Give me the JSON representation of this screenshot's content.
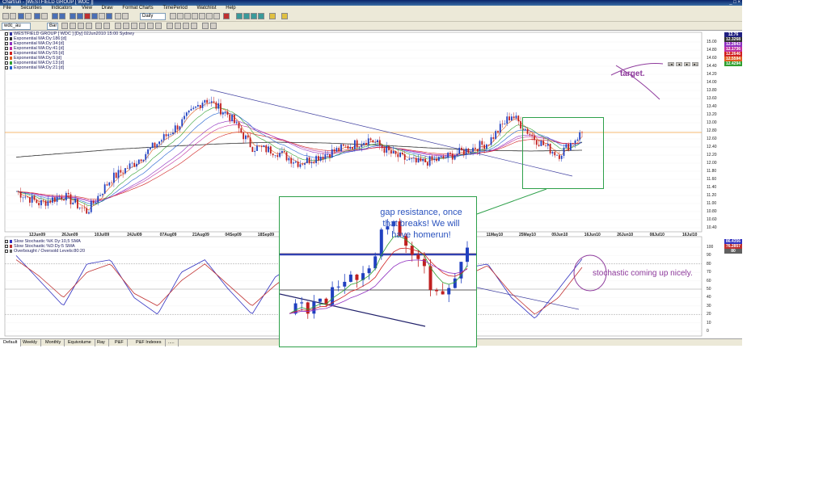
{
  "window": {
    "title": "Chartrun - [WESTFIELD GROUP [ WDC ]]",
    "controls": "_ □ ×"
  },
  "menu": [
    "File",
    "Securities",
    "Indicators",
    "View",
    "Draw",
    "Format Charts",
    "TimePeriod",
    "Watchlist",
    "Help"
  ],
  "toolbar": {
    "period_select": "Daily",
    "symbol_select": "wdc_au",
    "chart_type_select": "Bar"
  },
  "price_legend": [
    {
      "label": "WESTFIELD GROUP [ WDC ] [Dy] 02Jun2010 15:00 Sydney",
      "color": "#3030a0"
    },
    {
      "label": "Exponential MA:Dy:186:[d]",
      "color": "#303030"
    },
    {
      "label": "Exponential MA:Dy:34:[d]",
      "color": "#9030c0"
    },
    {
      "label": "Exponential MA:Dy:41:[d]",
      "color": "#c030a0"
    },
    {
      "label": "Exponential MA:Dy:55:[d]",
      "color": "#d02020"
    },
    {
      "label": "Exponential MA:Dy:5:[d]",
      "color": "#e06020"
    },
    {
      "label": "Exponential MA:Dy:13:[d]",
      "color": "#30a030"
    },
    {
      "label": "Exponential MA:Dy:21:[d]",
      "color": "#2060d0"
    }
  ],
  "stoch_legend": [
    {
      "label": "Slow Stochastic %K Dy:10,5 SMA",
      "color": "#3030c0"
    },
    {
      "label": "Slow Stochastic %D:Dy:5 SMA",
      "color": "#c03030"
    },
    {
      "label": "Overbought / Oversold Levels:80:20",
      "color": "#606060"
    }
  ],
  "price_axis": [
    "15.00",
    "14.80",
    "14.60",
    "14.40",
    "14.20",
    "14.00",
    "13.80",
    "13.60",
    "13.40",
    "13.20",
    "13.00",
    "12.80",
    "12.60",
    "12.40",
    "12.20",
    "12.00",
    "11.80",
    "11.60",
    "11.40",
    "11.20",
    "11.00",
    "10.80",
    "10.60",
    "10.40"
  ],
  "stoch_axis": [
    "100",
    "90",
    "80",
    "70",
    "60",
    "50",
    "40",
    "30",
    "20",
    "10",
    "0"
  ],
  "date_axis": [
    "12Jun09",
    "26Jun09",
    "10Jul09",
    "24Jul09",
    "07Aug09",
    "21Aug09",
    "04Sep09",
    "18Sep09",
    "02Oct09",
    "16Oct09",
    "30Oct09",
    "25Mar10",
    "12Apr10",
    "27Apr10",
    "11May10",
    "25May10",
    "09Jun10",
    "16Jun10",
    "26Jun10",
    "08Jul10",
    "16Jul10"
  ],
  "badges": [
    {
      "text": "12.76",
      "color": "#202080"
    },
    {
      "text": "12.3268",
      "color": "#303030"
    },
    {
      "text": "12.2843",
      "color": "#9030c0"
    },
    {
      "text": "12.1736",
      "color": "#c030a0"
    },
    {
      "text": "12.2646",
      "color": "#d02020"
    },
    {
      "text": "12.5594",
      "color": "#e06020"
    },
    {
      "text": "12.4294",
      "color": "#30a030"
    },
    {
      "text": "86.4356",
      "color": "#3030c0"
    },
    {
      "text": "76.2857",
      "color": "#c03030"
    },
    {
      "text": "80",
      "color": "#606060"
    }
  ],
  "tabs": [
    "Default",
    "Weekly",
    "Monthly",
    "Equivolume",
    "Ray",
    "P&F",
    "P&F Indexes",
    "....."
  ],
  "annotations": {
    "gap": "gap resistance, once\nthat breaks!  We will\nhave homerun!",
    "target": "target.",
    "stochastic": "stochastic coming up nicely."
  },
  "colors": {
    "annotation_blue": "#2a52be",
    "annotation_purple": "#8e3a9c",
    "box_green": "#2ea04a"
  },
  "chart_data": {
    "type": "line",
    "price_ylim": [
      10.4,
      15.0
    ],
    "stoch_ylim": [
      0,
      100
    ],
    "resistance_level": 12.76,
    "ema186_series": [
      12.15,
      12.25,
      12.35,
      12.42,
      12.48,
      12.52,
      12.5,
      12.45,
      12.38,
      12.32,
      12.3,
      12.32
    ],
    "close_series": [
      11.3,
      11.0,
      11.2,
      10.8,
      11.6,
      12.0,
      12.5,
      13.0,
      13.6,
      13.2,
      12.4,
      12.3,
      12.0,
      12.2,
      12.4,
      12.6,
      12.2,
      12.0,
      12.1,
      12.3,
      12.5,
      13.2,
      12.6,
      12.2,
      12.76
    ],
    "stoch_k_series": [
      90,
      60,
      30,
      80,
      85,
      40,
      20,
      70,
      85,
      50,
      20,
      65,
      80,
      40,
      15,
      60,
      85,
      30,
      20,
      75,
      80,
      40,
      15,
      50,
      86
    ],
    "stoch_d_series": [
      85,
      65,
      40,
      70,
      80,
      45,
      30,
      60,
      80,
      55,
      30,
      55,
      75,
      45,
      25,
      55,
      80,
      40,
      25,
      65,
      78,
      45,
      20,
      40,
      76
    ],
    "overbought": 80,
    "oversold": 20
  }
}
